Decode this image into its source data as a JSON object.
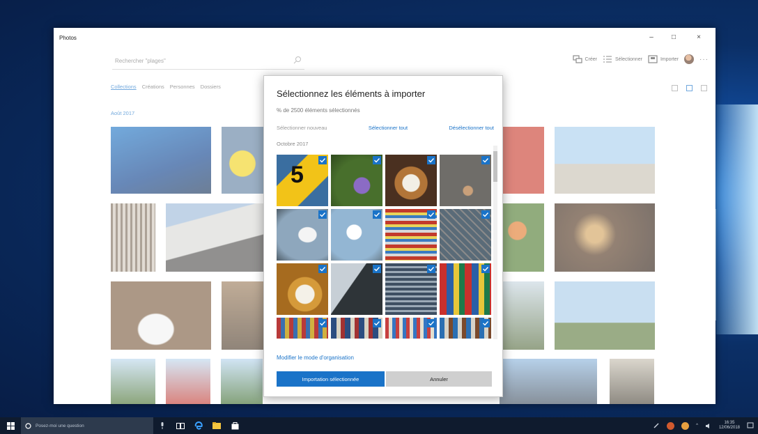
{
  "window": {
    "title": "Photos",
    "minimize": "–",
    "maximize": "□",
    "close": "×"
  },
  "search": {
    "placeholder": "Rechercher \"plages\""
  },
  "toolbar": {
    "create": "Créer",
    "select": "Sélectionner",
    "import": "Importer",
    "more": "···"
  },
  "tabs": [
    {
      "label": "Collections",
      "active": true
    },
    {
      "label": "Créations",
      "active": false
    },
    {
      "label": "Personnes",
      "active": false
    },
    {
      "label": "Dossiers",
      "active": false
    }
  ],
  "collection_date": "Août 2017",
  "dialog": {
    "title": "Sélectionnez les éléments à importer",
    "subtitle": "% de 2500 éléments sélectionnés",
    "select_new": "Sélectionner nouveau",
    "select_all": "Sélectionner tout",
    "deselect_all": "Désélectionner tout",
    "date_group": "Octobre 2017",
    "change_org": "Modifier le mode d'organisation",
    "import_button": "Importation sélectionnée",
    "cancel_button": "Annuler",
    "thumbnails": [
      {
        "name": "sign-5",
        "checked": true,
        "label": "5"
      },
      {
        "name": "lavender",
        "checked": true
      },
      {
        "name": "bread-bowl",
        "checked": true
      },
      {
        "name": "pigeon",
        "checked": true
      },
      {
        "name": "seagull",
        "checked": true
      },
      {
        "name": "gull-flying",
        "checked": true
      },
      {
        "name": "locks",
        "checked": true
      },
      {
        "name": "fence",
        "checked": true
      },
      {
        "name": "coffee-cups",
        "checked": true
      },
      {
        "name": "shadow",
        "checked": true
      },
      {
        "name": "stadium",
        "checked": true
      },
      {
        "name": "jerseys",
        "checked": true
      },
      {
        "name": "row4-a",
        "checked": true
      },
      {
        "name": "row4-b",
        "checked": true
      },
      {
        "name": "row4-c",
        "checked": true
      },
      {
        "name": "row4-d",
        "checked": true
      }
    ]
  },
  "taskbar": {
    "search_text": "Posez-moi une question",
    "time": "16:35",
    "date": "12/06/2018"
  },
  "colors": {
    "accent": "#1a73c8",
    "taskbar": "#0f1b2e"
  }
}
